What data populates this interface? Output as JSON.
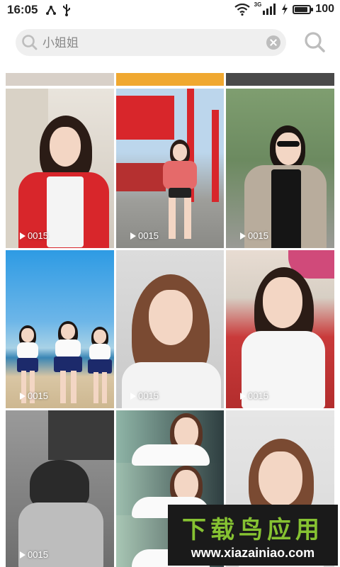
{
  "status_bar": {
    "time": "16:05",
    "network_label": "3G",
    "battery_level": 0.9,
    "battery_percent": "100"
  },
  "search": {
    "placeholder": "小姐姐",
    "value": ""
  },
  "videos": [
    {
      "count": "0015"
    },
    {
      "count": "0015"
    },
    {
      "count": "0015"
    },
    {
      "count": "0015"
    },
    {
      "count": "0015"
    },
    {
      "count": "0015"
    },
    {
      "count": "0015"
    }
  ],
  "watermark": {
    "title": "下载鸟应用",
    "url": "www.xiazainiao.com"
  },
  "colors": {
    "accent_red": "#d8262b",
    "search_bg": "#efefef",
    "watermark_green": "#86c232"
  }
}
